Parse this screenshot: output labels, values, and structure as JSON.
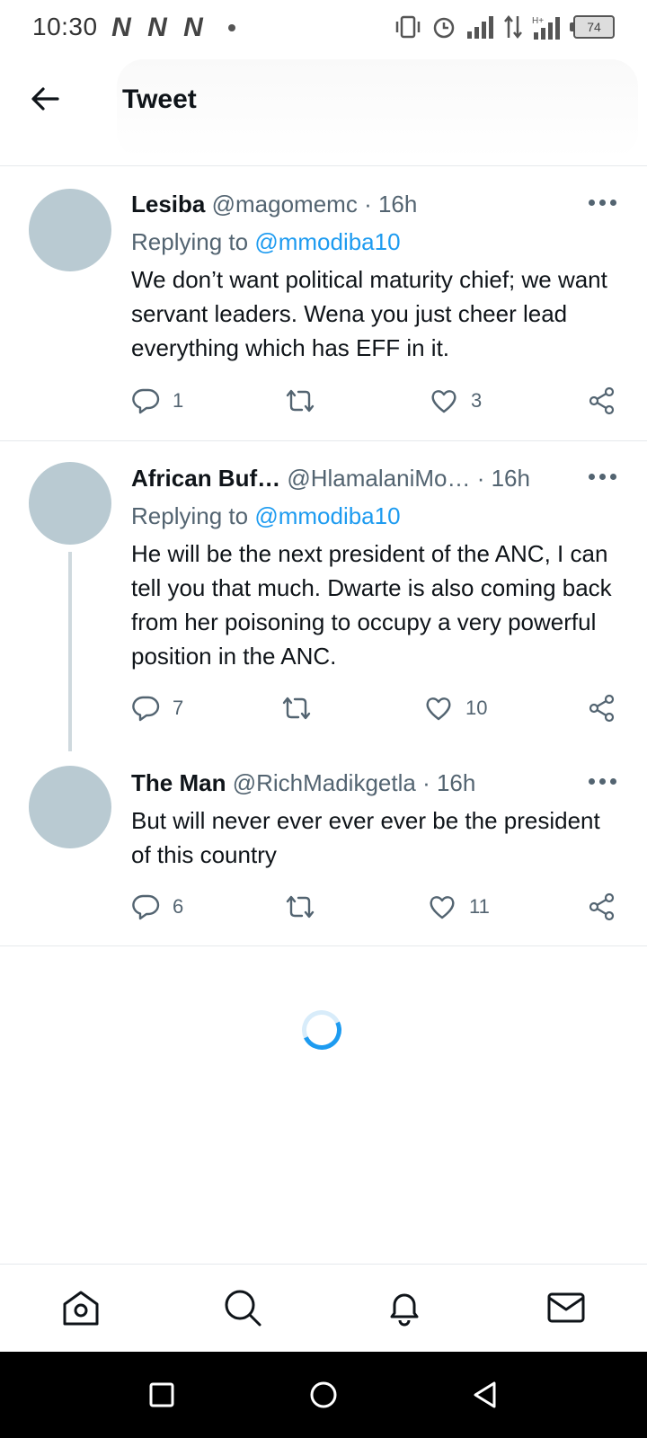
{
  "status_bar": {
    "time": "10:30",
    "notification_icons": [
      "N",
      "N",
      "N"
    ],
    "battery": "74"
  },
  "header": {
    "title": "Tweet"
  },
  "tweets": [
    {
      "name": "Lesiba",
      "handle": "@magomemc",
      "time": "· 16h",
      "replying_prefix": "Replying to ",
      "replying_to": "@mmodiba10",
      "text": "We don’t want political maturity chief; we want servant leaders. Wena you just cheer lead everything which has EFF in it.",
      "replies": "1",
      "retweets": "",
      "likes": "3"
    },
    {
      "name": "African Buf…",
      "handle": "@HlamalaniMo…",
      "time": "· 16h",
      "replying_prefix": "Replying to ",
      "replying_to": "@mmodiba10",
      "text": "He will be the next president of the ANC, I can tell you that much. Dwarte is also coming back from her poisoning to occupy a very powerful position in the ANC.",
      "replies": "7",
      "retweets": "",
      "likes": "10"
    },
    {
      "name": "The Man",
      "handle": "@RichMadikgetla",
      "time": "· 16h",
      "text": "But will never ever ever ever be the president of this country",
      "replies": "6",
      "retweets": "",
      "likes": "11"
    }
  ],
  "colors": {
    "accent": "#1d9bf0",
    "secondary_text": "#536471",
    "avatar_placeholder": "#b9cad2"
  },
  "bottom_nav": [
    "home-icon",
    "search-icon",
    "bell-icon",
    "mail-icon"
  ],
  "android_nav": [
    "recents-button",
    "home-button",
    "back-button"
  ]
}
